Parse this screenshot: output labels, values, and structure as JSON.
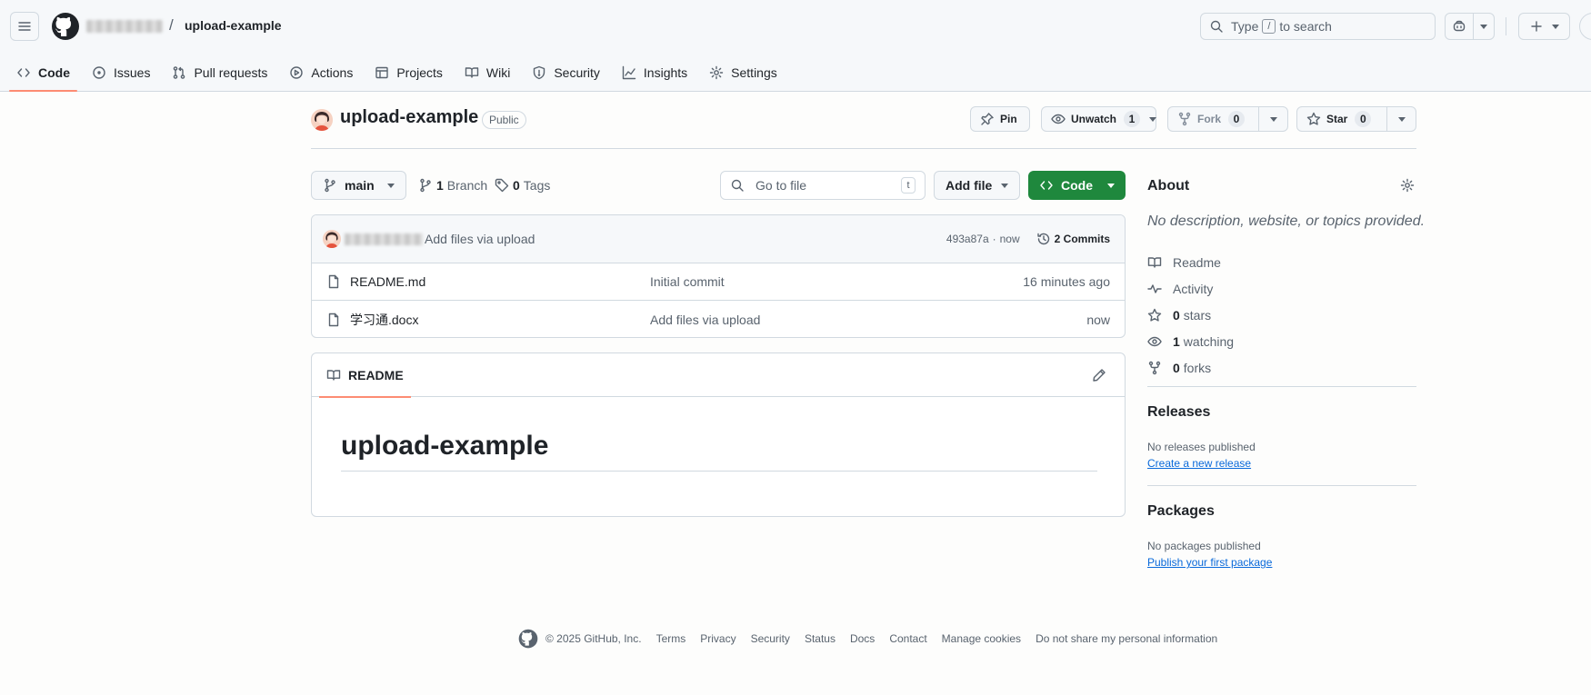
{
  "header": {
    "repo_name": "upload-example",
    "search_placeholder_prefix": "Type",
    "search_key": "/",
    "search_placeholder_suffix": "to search"
  },
  "nav": {
    "tabs": [
      {
        "label": "Code",
        "icon": "code-icon"
      },
      {
        "label": "Issues",
        "icon": "issue-icon"
      },
      {
        "label": "Pull requests",
        "icon": "pull-request-icon"
      },
      {
        "label": "Actions",
        "icon": "play-icon"
      },
      {
        "label": "Projects",
        "icon": "table-icon"
      },
      {
        "label": "Wiki",
        "icon": "book-icon"
      },
      {
        "label": "Security",
        "icon": "shield-icon"
      },
      {
        "label": "Insights",
        "icon": "graph-icon"
      },
      {
        "label": "Settings",
        "icon": "gear-icon"
      }
    ]
  },
  "repo": {
    "title": "upload-example",
    "visibility": "Public",
    "pin_label": "Pin",
    "unwatch_label": "Unwatch",
    "watch_count": "1",
    "fork_label": "Fork",
    "fork_count": "0",
    "star_label": "Star",
    "star_count": "0"
  },
  "filenav": {
    "branch": "main",
    "branch_count": "1",
    "branch_label": "Branch",
    "tag_count": "0",
    "tag_label": "Tags",
    "goto_placeholder": "Go to file",
    "goto_key": "t",
    "add_file_label": "Add file",
    "code_label": "Code"
  },
  "commit": {
    "message": "Add files via upload",
    "sha": "493a87a",
    "separator": "·",
    "time": "now",
    "commits_label": "2 Commits"
  },
  "files": [
    {
      "name": "README.md",
      "message": "Initial commit",
      "time": "16 minutes ago"
    },
    {
      "name": "学习通.docx",
      "message": "Add files via upload",
      "time": "now"
    }
  ],
  "readme": {
    "tab_label": "README",
    "heading": "upload-example"
  },
  "about": {
    "title": "About",
    "description": "No description, website, or topics provided.",
    "readme_label": "Readme",
    "activity_label": "Activity",
    "stars_count": "0",
    "stars_label": "stars",
    "watching_count": "1",
    "watching_label": "watching",
    "forks_count": "0",
    "forks_label": "forks"
  },
  "releases": {
    "title": "Releases",
    "empty": "No releases published",
    "link": "Create a new release"
  },
  "packages": {
    "title": "Packages",
    "empty": "No packages published",
    "link": "Publish your first package"
  },
  "footer": {
    "copyright": "© 2025 GitHub, Inc.",
    "links": [
      "Terms",
      "Privacy",
      "Security",
      "Status",
      "Docs",
      "Contact",
      "Manage cookies",
      "Do not share my personal information"
    ]
  },
  "colors": {
    "accent_green": "#1f883d",
    "active_tab_underline": "#fd8c73",
    "link_blue": "#0969da"
  }
}
